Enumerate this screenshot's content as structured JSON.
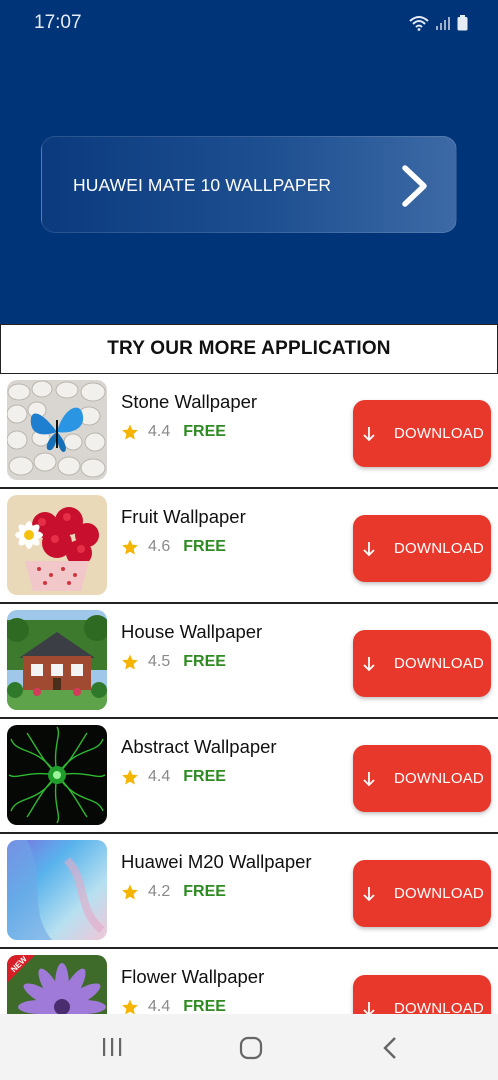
{
  "status_bar": {
    "time": "17:07"
  },
  "banner": {
    "title": "HUAWEI MATE 10 WALLPAPER"
  },
  "section": {
    "title": "TRY OUR MORE APPLICATION"
  },
  "apps": [
    {
      "name": "Stone Wallpaper",
      "rating": "4.4",
      "price": "FREE",
      "button": "DOWNLOAD",
      "thumb": "butterfly-on-stones"
    },
    {
      "name": "Fruit Wallpaper",
      "rating": "4.6",
      "price": "FREE",
      "button": "DOWNLOAD",
      "thumb": "raspberries-with-daisy"
    },
    {
      "name": "House Wallpaper",
      "rating": "4.5",
      "price": "FREE",
      "button": "DOWNLOAD",
      "thumb": "brick-house"
    },
    {
      "name": "Abstract Wallpaper",
      "rating": "4.4",
      "price": "FREE",
      "button": "DOWNLOAD",
      "thumb": "green-abstract"
    },
    {
      "name": "Huawei M20 Wallpaper",
      "rating": "4.2",
      "price": "FREE",
      "button": "DOWNLOAD",
      "thumb": "pastel-gradient"
    },
    {
      "name": "Flower Wallpaper",
      "rating": "4.4",
      "price": "FREE",
      "button": "DOWNLOAD",
      "thumb": "purple-flower",
      "badge": "NEW"
    }
  ],
  "colors": {
    "header": "#003479",
    "download": "#e8372b",
    "free": "#2e8b22",
    "star": "#f5b400"
  }
}
